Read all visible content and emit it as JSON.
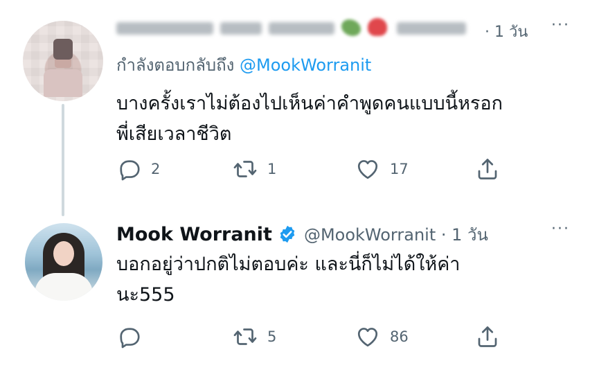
{
  "thread": {
    "tweets": [
      {
        "display_name": "",
        "time": "· 1 วัน",
        "replying_prefix": "กำลังตอบกลับถึง ",
        "replying_to": "@MookWorranit",
        "text_line_1": "บางครั้งเราไม่ต้องไปเห็นค่าคำพูดคนแบบนี้หรอก",
        "text_line_2": "พี่เสียเวลาชีวิต",
        "replies": "2",
        "retweets": "1",
        "likes": "17"
      },
      {
        "display_name": "Mook Worranit",
        "handle_time": "@MookWorranit · 1 วัน",
        "text_line_1": "บอกอยู่ว่าปกติไม่ตอบค่ะ และนี่ก็ไม่ได้ให้ค่า",
        "text_line_2": "นะ555",
        "replies": "",
        "retweets": "5",
        "likes": "86"
      }
    ],
    "more_label": "···"
  },
  "icons": {
    "reply": "reply-icon",
    "retweet": "retweet-icon",
    "like": "heart-icon",
    "share": "share-icon",
    "verified": "verified-badge-icon"
  },
  "colors": {
    "text": "#0f1419",
    "secondary": "#536471",
    "accent": "#1d9bf0",
    "thread_line": "#cfd9de"
  }
}
